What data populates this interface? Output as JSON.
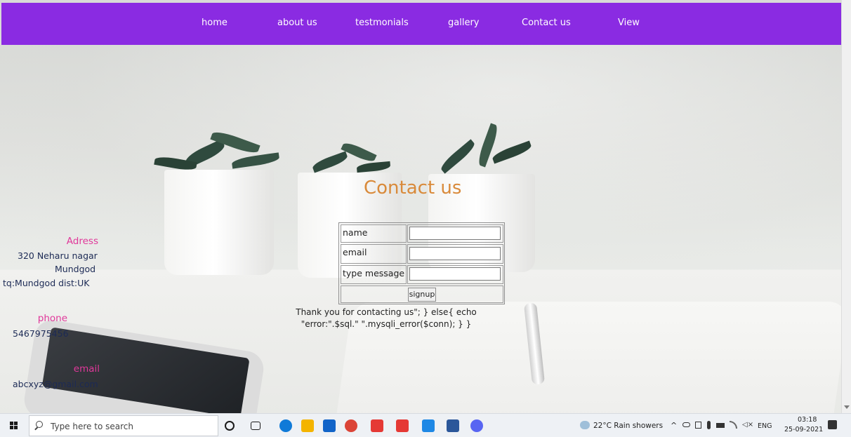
{
  "nav": {
    "items": [
      {
        "label": "home"
      },
      {
        "label": "about us"
      },
      {
        "label": "testmonials"
      },
      {
        "label": "gallery"
      },
      {
        "label": "Contact us"
      },
      {
        "label": "View"
      }
    ]
  },
  "contact": {
    "title": "Contact us",
    "name_label": "name",
    "email_label": "email",
    "message_label": "type message",
    "submit_label": "signup",
    "echo_text": "Thank you for contacting us\"; } else{ echo \"error:\".$sql.\" \".mysqli_error($conn); } }"
  },
  "info": {
    "address_label": "Adress",
    "address_lines": [
      "320 Neharu nagar",
      "Mundgod",
      "tq:Mundgod dist:UK"
    ],
    "phone_label": "phone",
    "phone_value": "5467975456",
    "email_label": "email",
    "email_value": "abcxyz@gmail.com"
  },
  "taskbar": {
    "search_placeholder": "Type here to search",
    "weather": "22°C  Rain showers",
    "language": "ENG",
    "time": "03:18",
    "date": "25-09-2021",
    "apps": [
      {
        "icon": "cortana-icon",
        "color": "#1a1a1a"
      },
      {
        "icon": "task-view-icon",
        "color": "#1a1a1a"
      },
      {
        "icon": "edge-icon",
        "color": "#0f7ad8"
      },
      {
        "icon": "file-explorer-icon",
        "color": "#f4b400"
      },
      {
        "icon": "mail-icon",
        "color": "#1264c8"
      },
      {
        "icon": "chrome-icon",
        "color": "#db4437"
      },
      {
        "icon": "red-app-icon",
        "color": "#e53935"
      },
      {
        "icon": "red-app-2-icon",
        "color": "#e53935"
      },
      {
        "icon": "vscode-icon",
        "color": "#1e88e5"
      },
      {
        "icon": "word-icon",
        "color": "#2b579a"
      },
      {
        "icon": "discord-icon",
        "color": "#5865f2"
      }
    ]
  }
}
